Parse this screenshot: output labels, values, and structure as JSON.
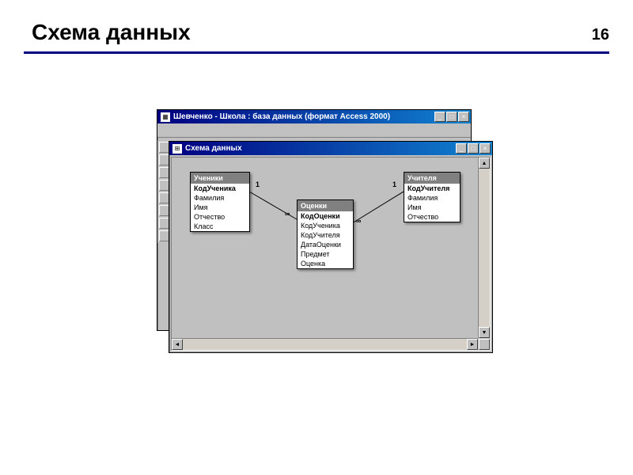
{
  "slide": {
    "title": "Схема данных",
    "page": "16"
  },
  "window_back": {
    "title": "Шевченко - Школа : база данных (формат Access 2000)"
  },
  "window_front": {
    "title": "Схема данных"
  },
  "tables": {
    "students": {
      "name": "Ученики",
      "fields": [
        "КодУченика",
        "Фамилия",
        "Имя",
        "Отчество",
        "Класс"
      ]
    },
    "grades": {
      "name": "Оценки",
      "fields": [
        "КодОценки",
        "КодУченика",
        "КодУчителя",
        "ДатаОценки",
        "Предмет",
        "Оценка"
      ]
    },
    "teachers": {
      "name": "Учителя",
      "fields": [
        "КодУчителя",
        "Фамилия",
        "Имя",
        "Отчество"
      ]
    }
  },
  "rel": {
    "one": "1",
    "many": "∞"
  },
  "buttons": {
    "min": "_",
    "max": "□",
    "close": "×",
    "up": "▲",
    "down": "▼",
    "left": "◄",
    "right": "►"
  }
}
